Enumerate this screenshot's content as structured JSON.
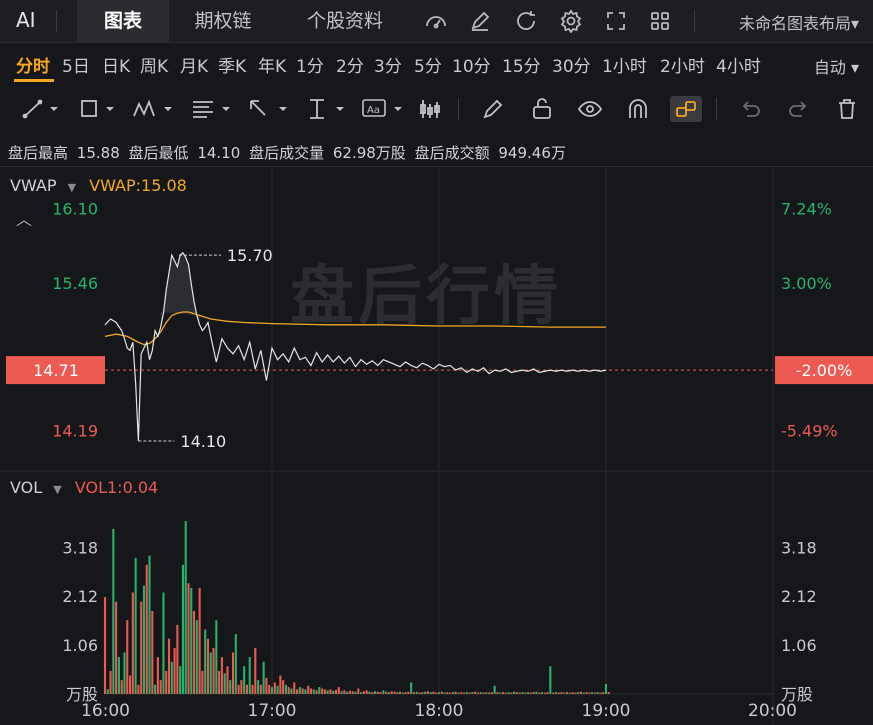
{
  "topbar": {
    "ai_label": "AI",
    "tabs": [
      {
        "label": "图表",
        "active": true
      },
      {
        "label": "期权链",
        "active": false
      },
      {
        "label": "个股资料",
        "active": false
      }
    ],
    "icons": [
      "gauge-icon",
      "edit-icon",
      "refresh-icon",
      "settings-icon",
      "fullscreen-icon",
      "grid-icon"
    ],
    "layout_name": "未命名图表布局▾"
  },
  "periods": [
    "分时",
    "5日",
    "日K",
    "周K",
    "月K",
    "季K",
    "年K",
    "1分",
    "2分",
    "3分",
    "5分",
    "10分",
    "15分",
    "30分",
    "1小时",
    "2小时",
    "4小时"
  ],
  "active_period": "分时",
  "auto_select": "自动",
  "stats": [
    {
      "label": "盘后最高",
      "value": "15.88"
    },
    {
      "label": "盘后最低",
      "value": "14.10"
    },
    {
      "label": "盘后成交量",
      "value": "62.98万股"
    },
    {
      "label": "盘后成交额",
      "value": "949.46万"
    }
  ],
  "colors": {
    "price_line": "#e6e6e6",
    "vwap_line": "#f5a623",
    "up": "#ec5a52",
    "down": "#26b36a",
    "current_price_bg": "#ec5a52"
  },
  "watermark": "盘后行情",
  "chart_data": [
    {
      "type": "line",
      "indicator_label": "VWAP",
      "indicator_value": "VWAP:15.08",
      "x_ticks": [
        "16:00",
        "17:00",
        "18:00",
        "19:00",
        "20:00"
      ],
      "xlim": [
        0,
        240
      ],
      "ylim": [
        13.85,
        16.45
      ],
      "y_ticks_left": [
        {
          "value": 16.1,
          "label": "16.10",
          "color": "#26b36a"
        },
        {
          "value": 15.46,
          "label": "15.46",
          "color": "#26b36a"
        },
        {
          "value": 14.19,
          "label": "14.19",
          "color": "#ec5a52"
        }
      ],
      "y_ticks_right": [
        {
          "value": 16.1,
          "label": "7.24%",
          "color": "#26b36a"
        },
        {
          "value": 15.46,
          "label": "3.00%",
          "color": "#26b36a"
        },
        {
          "value": 14.19,
          "label": "-5.49%",
          "color": "#ec5a52"
        }
      ],
      "current_price": 14.71,
      "current_price_label": "14.71",
      "current_pct_label": "-2.00%",
      "high_label": "15.70",
      "high_point": {
        "x": 28,
        "y": 15.7
      },
      "low_label": "14.10",
      "low_point": {
        "x": 12,
        "y": 14.1
      },
      "price": {
        "x": [
          0,
          2,
          4,
          6,
          7,
          8,
          9,
          10,
          11,
          12,
          13,
          14,
          15,
          16,
          17,
          18,
          19,
          20,
          21,
          22,
          23,
          24,
          25,
          26,
          27,
          28,
          29,
          30,
          31,
          32,
          33,
          34,
          35,
          36,
          37,
          38,
          40,
          42,
          44,
          46,
          48,
          50,
          52,
          54,
          56,
          58,
          60,
          62,
          64,
          66,
          68,
          70,
          72,
          74,
          76,
          78,
          80,
          82,
          84,
          86,
          88,
          90,
          92,
          94,
          96,
          98,
          100,
          102,
          104,
          106,
          108,
          110,
          112,
          114,
          116,
          118,
          120,
          122,
          124,
          126,
          128,
          130,
          132,
          134,
          136,
          138,
          140,
          142,
          144,
          146,
          148,
          150,
          152,
          154,
          156,
          158,
          160,
          162,
          164,
          166,
          168,
          170,
          172,
          174,
          176,
          178,
          180
        ],
        "y": [
          15.1,
          15.15,
          15.12,
          15.05,
          14.98,
          14.9,
          14.88,
          14.95,
          14.6,
          14.1,
          14.85,
          14.9,
          14.95,
          14.8,
          14.88,
          15.05,
          15.0,
          15.08,
          15.2,
          15.4,
          15.55,
          15.7,
          15.65,
          15.6,
          15.7,
          15.72,
          15.68,
          15.62,
          15.45,
          15.3,
          15.18,
          15.1,
          15.05,
          15.08,
          15.12,
          15.0,
          14.78,
          14.98,
          14.9,
          14.85,
          14.92,
          14.8,
          14.95,
          14.72,
          14.88,
          14.62,
          14.9,
          14.8,
          14.85,
          14.78,
          14.9,
          14.8,
          14.82,
          14.75,
          14.86,
          14.78,
          14.84,
          14.78,
          14.83,
          14.77,
          14.82,
          14.74,
          14.8,
          14.76,
          14.79,
          14.75,
          14.8,
          14.78,
          14.76,
          14.74,
          14.78,
          14.75,
          14.73,
          14.77,
          14.75,
          14.72,
          14.76,
          14.74,
          14.75,
          14.71,
          14.73,
          14.69,
          14.72,
          14.7,
          14.73,
          14.68,
          14.71,
          14.7,
          14.72,
          14.69,
          14.7,
          14.71,
          14.7,
          14.72,
          14.69,
          14.7,
          14.71,
          14.7,
          14.71,
          14.7,
          14.71,
          14.7,
          14.71,
          14.7,
          14.71,
          14.7,
          14.71
        ]
      },
      "vwap": {
        "x": [
          0,
          4,
          8,
          12,
          14,
          16,
          18,
          20,
          22,
          24,
          26,
          28,
          30,
          34,
          38,
          44,
          50,
          60,
          80,
          100,
          120,
          140,
          160,
          180
        ],
        "y": [
          15.0,
          15.02,
          15.0,
          14.95,
          14.93,
          14.94,
          14.98,
          15.04,
          15.12,
          15.18,
          15.2,
          15.21,
          15.21,
          15.18,
          15.15,
          15.13,
          15.12,
          15.11,
          15.1,
          15.1,
          15.09,
          15.09,
          15.08,
          15.08
        ]
      }
    },
    {
      "type": "bar",
      "indicator_label": "VOL",
      "indicator_value": "VOL1:0.04",
      "unit_label": "万股",
      "ylim": [
        0,
        4.25
      ],
      "y_ticks": [
        {
          "value": 3.18,
          "label": "3.18"
        },
        {
          "value": 2.12,
          "label": "2.12"
        },
        {
          "value": 1.06,
          "label": "1.06"
        }
      ],
      "x_start": 0,
      "x_step": 1,
      "values": [
        2.1,
        0.1,
        0.5,
        3.58,
        2.0,
        0.8,
        0.3,
        0.9,
        1.6,
        0.4,
        2.2,
        2.95,
        0.2,
        2.0,
        2.35,
        2.8,
        3.0,
        1.8,
        0.2,
        0.8,
        0.3,
        2.2,
        0.5,
        1.2,
        0.7,
        1.0,
        1.5,
        0.6,
        2.8,
        3.75,
        2.4,
        2.3,
        1.8,
        1.6,
        2.3,
        0.5,
        1.4,
        1.2,
        0.9,
        1.0,
        1.6,
        0.5,
        0.8,
        0.45,
        0.6,
        0.3,
        0.9,
        1.3,
        0.2,
        0.3,
        0.6,
        0.2,
        0.8,
        0.2,
        1.0,
        0.3,
        0.2,
        0.7,
        0.35,
        0.2,
        0.15,
        0.25,
        0.18,
        0.4,
        0.3,
        0.2,
        0.15,
        0.12,
        0.25,
        0.1,
        0.15,
        0.12,
        0.1,
        0.18,
        0.12,
        0.1,
        0.08,
        0.15,
        0.12,
        0.1,
        0.08,
        0.1,
        0.07,
        0.09,
        0.15,
        0.06,
        0.08,
        0.05,
        0.07,
        0.06,
        0.05,
        0.12,
        0.04,
        0.06,
        0.08,
        0.05,
        0.04,
        0.06,
        0.05,
        0.04,
        0.08,
        0.05,
        0.04,
        0.06,
        0.05,
        0.04,
        0.05,
        0.03,
        0.04,
        0.05,
        0.25,
        0.04,
        0.05,
        0.03,
        0.04,
        0.05,
        0.06,
        0.04,
        0.05,
        0.03,
        0.04,
        0.05,
        0.03,
        0.04,
        0.03,
        0.04,
        0.05,
        0.03,
        0.04,
        0.03,
        0.04,
        0.03,
        0.04,
        0.05,
        0.03,
        0.04,
        0.03,
        0.04,
        0.03,
        0.04,
        0.18,
        0.04,
        0.03,
        0.04,
        0.03,
        0.04,
        0.03,
        0.05,
        0.04,
        0.03,
        0.04,
        0.03,
        0.04,
        0.03,
        0.04,
        0.05,
        0.03,
        0.04,
        0.03,
        0.04,
        0.6,
        0.03,
        0.04,
        0.03,
        0.04,
        0.03,
        0.04,
        0.03,
        0.04,
        0.03,
        0.04,
        0.05,
        0.03,
        0.04,
        0.03,
        0.04,
        0.03,
        0.04,
        0.03,
        0.04,
        0.22,
        0.04
      ],
      "up": [
        true,
        false,
        true,
        false,
        true,
        false,
        true,
        false,
        true,
        true,
        true,
        false,
        true,
        true,
        false,
        true,
        false,
        true,
        false,
        true,
        true,
        false,
        true,
        true,
        false,
        true,
        true,
        false,
        false,
        false,
        true,
        false,
        true,
        false,
        true,
        true,
        false,
        true,
        false,
        true,
        false,
        true,
        true,
        false,
        true,
        false,
        true,
        false,
        true,
        true,
        false,
        true,
        false,
        true,
        true,
        false,
        true,
        false,
        true,
        true,
        false,
        true,
        false,
        true,
        true,
        false,
        true,
        false,
        true,
        true,
        false,
        true,
        false,
        true,
        true,
        false,
        true,
        false,
        true,
        true,
        false,
        true,
        false,
        true,
        true,
        false,
        true,
        false,
        true,
        true,
        false,
        true,
        false,
        true,
        true,
        false,
        true,
        false,
        true,
        true,
        false,
        true,
        false,
        true,
        true,
        false,
        true,
        false,
        true,
        true,
        false,
        true,
        false,
        true,
        true,
        false,
        true,
        false,
        true,
        true,
        false,
        true,
        false,
        true,
        true,
        false,
        true,
        false,
        true,
        true,
        false,
        true,
        false,
        true,
        true,
        false,
        true,
        false,
        true,
        true,
        false,
        true,
        false,
        true,
        true,
        false,
        true,
        false,
        true,
        true,
        false,
        true,
        false,
        true,
        true,
        false,
        true,
        false,
        true,
        true,
        false,
        true,
        false,
        true,
        true,
        false,
        true,
        false,
        true,
        true,
        false,
        true,
        false,
        true,
        true,
        false,
        true,
        false,
        true,
        true,
        false,
        true,
        false,
        true
      ]
    }
  ]
}
